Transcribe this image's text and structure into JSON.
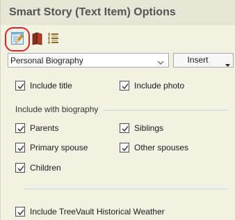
{
  "panel": {
    "title": "Smart Story (Text Item) Options"
  },
  "toolbar": {
    "icons": [
      {
        "name": "edit-text-icon",
        "selected": true
      },
      {
        "name": "book-icon",
        "selected": false
      },
      {
        "name": "outline-list-icon",
        "selected": false
      }
    ]
  },
  "story_select": {
    "value": "Personal Biography"
  },
  "insert_button": {
    "label": "Insert"
  },
  "options": {
    "include_title": {
      "label": "Include title",
      "checked": true
    },
    "include_photo": {
      "label": "Include photo",
      "checked": true
    }
  },
  "biography_group": {
    "label": "Include with biography",
    "parents": {
      "label": "Parents",
      "checked": true
    },
    "siblings": {
      "label": "Siblings",
      "checked": true
    },
    "primary_spouse": {
      "label": "Primary spouse",
      "checked": true
    },
    "other_spouses": {
      "label": "Other spouses",
      "checked": true
    },
    "children": {
      "label": "Children",
      "checked": true
    }
  },
  "weather": {
    "label": "Include TreeVault Historical Weather",
    "checked": true
  },
  "colors": {
    "panel_bg": "#f2f2e3",
    "title_bg": "#e6e6d6",
    "highlight": "#d9232e"
  }
}
